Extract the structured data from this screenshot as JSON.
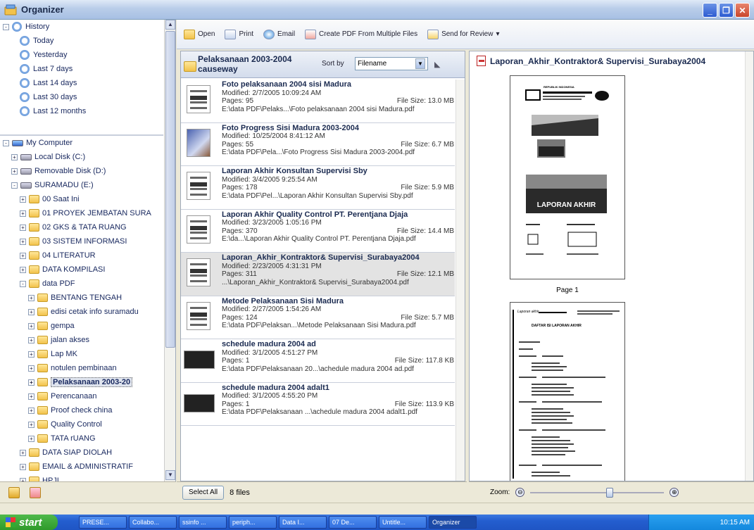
{
  "window": {
    "title": "Organizer"
  },
  "history": [
    {
      "label": "History",
      "root": true
    },
    {
      "label": "Today"
    },
    {
      "label": "Yesterday"
    },
    {
      "label": "Last 7 days"
    },
    {
      "label": "Last 14 days"
    },
    {
      "label": "Last 30 days"
    },
    {
      "label": "Last 12 months"
    }
  ],
  "tree": [
    {
      "label": "My Computer",
      "level": 0,
      "exp": "-",
      "type": "computer"
    },
    {
      "label": "Local Disk (C:)",
      "level": 1,
      "exp": "+",
      "type": "drive"
    },
    {
      "label": "Removable Disk (D:)",
      "level": 1,
      "exp": "+",
      "type": "drive"
    },
    {
      "label": "SURAMADU (E:)",
      "level": 1,
      "exp": "-",
      "type": "drive"
    },
    {
      "label": "00 Saat Ini",
      "level": 2,
      "exp": "+",
      "type": "folder"
    },
    {
      "label": "01 PROYEK JEMBATAN SURA",
      "level": 2,
      "exp": "+",
      "type": "folder"
    },
    {
      "label": "02 GKS & TATA RUANG",
      "level": 2,
      "exp": "+",
      "type": "folder"
    },
    {
      "label": "03 SISTEM INFORMASI",
      "level": 2,
      "exp": "+",
      "type": "folder"
    },
    {
      "label": "04 LITERATUR",
      "level": 2,
      "exp": "+",
      "type": "folder"
    },
    {
      "label": "DATA KOMPILASI",
      "level": 2,
      "exp": "+",
      "type": "folder"
    },
    {
      "label": "data PDF",
      "level": 2,
      "exp": "-",
      "type": "folder"
    },
    {
      "label": "BENTANG TENGAH",
      "level": 3,
      "exp": "+",
      "type": "folder"
    },
    {
      "label": "edisi cetak info suramadu",
      "level": 3,
      "exp": "+",
      "type": "folder"
    },
    {
      "label": "gempa",
      "level": 3,
      "exp": "+",
      "type": "folder"
    },
    {
      "label": "jalan akses",
      "level": 3,
      "exp": "+",
      "type": "folder"
    },
    {
      "label": "Lap MK",
      "level": 3,
      "exp": "+",
      "type": "folder"
    },
    {
      "label": "notulen pembinaan",
      "level": 3,
      "exp": "+",
      "type": "folder"
    },
    {
      "label": "Pelaksanaan 2003-20",
      "level": 3,
      "exp": "+",
      "type": "folder",
      "selected": true
    },
    {
      "label": "Perencanaan",
      "level": 3,
      "exp": "+",
      "type": "folder"
    },
    {
      "label": "Proof check china",
      "level": 3,
      "exp": "+",
      "type": "folder"
    },
    {
      "label": "Quality Control",
      "level": 3,
      "exp": "+",
      "type": "folder"
    },
    {
      "label": "TATA rUANG",
      "level": 3,
      "exp": "+",
      "type": "folder"
    },
    {
      "label": "DATA SIAP DIOLAH",
      "level": 2,
      "exp": "+",
      "type": "folder"
    },
    {
      "label": "EMAIL & ADMINISTRATIF",
      "level": 2,
      "exp": "+",
      "type": "folder"
    },
    {
      "label": "HPJI",
      "level": 2,
      "exp": "+",
      "type": "folder"
    }
  ],
  "toolbar": {
    "open": "Open",
    "print": "Print",
    "email": "Email",
    "create_pdf": "Create PDF From Multiple Files",
    "send_review": "Send for Review",
    "send_review_arrow": "▾"
  },
  "folder": {
    "title": "Pelaksanaan 2003-2004 causeway",
    "sort_label": "Sort by",
    "sort_value": "Filename",
    "sort_arrow": "▼",
    "sort_dir": "◣"
  },
  "files": [
    {
      "name": "Foto pelaksanaan 2004 sisi Madura",
      "modified": "Modified: 2/7/2005 10:09:24 AM",
      "pages": "Pages: 95",
      "size": "File Size: 13.0 MB",
      "path": "E:\\data PDF\\Pelaks...\\Foto pelaksanaan 2004 sisi Madura.pdf",
      "thumb": "doc"
    },
    {
      "name": "Foto Progress Sisi Madura 2003-2004",
      "modified": "Modified: 10/25/2004 8:41:12 AM",
      "pages": "Pages: 55",
      "size": "File Size: 6.7 MB",
      "path": "E:\\data PDF\\Pela...\\Foto Progress Sisi Madura 2003-2004.pdf",
      "thumb": "color"
    },
    {
      "name": "Laporan Akhir Konsultan Supervisi Sby",
      "modified": "Modified: 3/4/2005 9:25:54 AM",
      "pages": "Pages: 178",
      "size": "File Size: 5.9 MB",
      "path": "E:\\data PDF\\Pel...\\Laporan Akhir Konsultan Supervisi Sby.pdf",
      "thumb": "doc"
    },
    {
      "name": "Laporan Akhir Quality Control PT. Perentjana Djaja",
      "modified": "Modified: 3/23/2005 1:05:16 PM",
      "pages": "Pages: 370",
      "size": "File Size: 14.4 MB",
      "path": "E:\\da...\\Laporan Akhir Quality Control PT. Perentjana Djaja.pdf",
      "thumb": "doc"
    },
    {
      "name": "Laporan_Akhir_Kontraktor& Supervisi_Surabaya2004",
      "modified": "Modified: 2/23/2005 4:31:31 PM",
      "pages": "Pages: 311",
      "size": "File Size: 12.1 MB",
      "path": "...\\Laporan_Akhir_Kontraktor& Supervisi_Surabaya2004.pdf",
      "thumb": "doc",
      "selected": true
    },
    {
      "name": "Metode Pelaksanaan Sisi Madura",
      "modified": "Modified: 2/27/2005 1:54:26 AM",
      "pages": "Pages: 124",
      "size": "File Size: 5.7 MB",
      "path": "E:\\data PDF\\Pelaksan...\\Metode Pelaksanaan Sisi Madura.pdf",
      "thumb": "doc"
    },
    {
      "name": "schedule madura 2004 ad",
      "modified": "Modified: 3/1/2005 4:51:27 PM",
      "pages": "Pages: 1",
      "size": "File Size: 117.8 KB",
      "path": "E:\\data PDF\\Pelaksanaan 20...\\achedule madura 2004 ad.pdf",
      "thumb": "dark"
    },
    {
      "name": "schedule madura 2004 adalt1",
      "modified": "Modified: 3/1/2005 4:55:20 PM",
      "pages": "Pages: 1",
      "size": "File Size: 113.9 KB",
      "path": "E:\\data PDF\\Pelaksanaan ...\\achedule madura 2004 adalt1.pdf",
      "thumb": "dark"
    }
  ],
  "footer": {
    "select_all": "Select All",
    "count": "8 files"
  },
  "preview": {
    "title": "Laporan_Akhir_Kontraktor& Supervisi_Surabaya2004",
    "page1_label": "Page 1",
    "cover_text": "LAPORAN AKHIR",
    "cover_header": "REPUBLIK INDONESIA",
    "page2_header": "Laporan akhir",
    "page2_title": "DAFTAR ISI LAPORAN AKHIR"
  },
  "zoom": {
    "label": "Zoom:",
    "minus": "⊖",
    "plus": "⊕",
    "level_fraction": 0.6
  },
  "taskbar": {
    "start": "start",
    "tasks": [
      "PRESE...",
      "Collabo...",
      "ssinfo ...",
      "periph...",
      "Data I...",
      "07 De...",
      "Untitle...",
      "Organizer"
    ],
    "time": "10:15 AM"
  },
  "colors": {
    "accent": "#245ecf",
    "selection": "#e3e3e3",
    "folder": "#f2c24b"
  }
}
